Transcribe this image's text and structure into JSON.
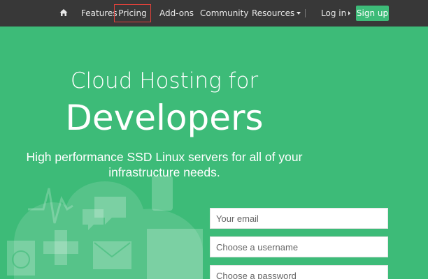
{
  "nav": {
    "home_icon": "home-icon",
    "items": {
      "features": "Features",
      "pricing": "Pricing",
      "addons": "Add-ons",
      "community": "Community",
      "resources": "Resources"
    },
    "login": "Log in",
    "signup": "Sign up"
  },
  "hero": {
    "line1": "Cloud Hosting for",
    "line2": "Developers",
    "subtitle_line1": "High performance SSD Linux servers for all of your",
    "subtitle_line2": "infrastructure needs."
  },
  "form": {
    "email_placeholder": "Your email",
    "username_placeholder": "Choose a username",
    "password_placeholder": "Choose a password"
  },
  "colors": {
    "brand_green": "#3dbb78",
    "nav_bg": "#383838",
    "highlight_border": "#e0413a"
  }
}
